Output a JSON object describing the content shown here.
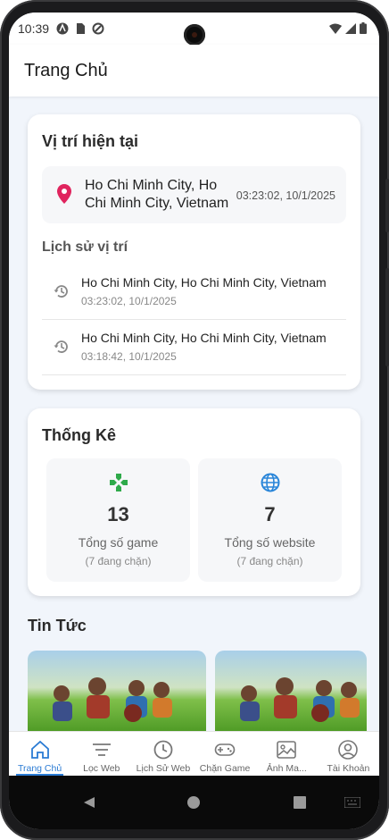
{
  "status_bar": {
    "time": "10:39"
  },
  "app_bar": {
    "title": "Trang Chủ"
  },
  "location_card": {
    "title": "Vị trí hiện tại",
    "current": {
      "address_line1": "Ho Chi Minh City, Ho",
      "address_line2": "Chi Minh City, Vietnam",
      "time": "03:23:02, 10/1/2025"
    },
    "history_title": "Lịch sử vị trí",
    "history": [
      {
        "address": "Ho Chi Minh City, Ho Chi Minh City, Vietnam",
        "time": "03:23:02, 10/1/2025"
      },
      {
        "address": "Ho Chi Minh City, Ho Chi Minh City, Vietnam",
        "time": "03:18:42, 10/1/2025"
      }
    ]
  },
  "stats_card": {
    "title": "Thống Kê",
    "games": {
      "count": "13",
      "label": "Tổng số game",
      "sub": "(7 đang chặn)",
      "icon": "gamepad-icon"
    },
    "websites": {
      "count": "7",
      "label": "Tổng số website",
      "sub": "(7 đang chặn)",
      "icon": "globe-icon"
    }
  },
  "news": {
    "title": "Tin Tức"
  },
  "bottom_nav": [
    {
      "label": "Trang Chủ",
      "icon": "home-icon",
      "active": true
    },
    {
      "label": "Lọc Web",
      "icon": "filter-icon",
      "active": false
    },
    {
      "label": "Lịch Sử Web",
      "icon": "clock-icon",
      "active": false
    },
    {
      "label": "Chặn Game",
      "icon": "gamepad-icon",
      "active": false
    },
    {
      "label": "Ảnh Ma...",
      "icon": "image-icon",
      "active": false
    },
    {
      "label": "Tài Khoản",
      "icon": "account-icon",
      "active": false
    }
  ],
  "colors": {
    "accent": "#2a7bd4",
    "pin": "#e0245e",
    "game_icon": "#2eaa4a",
    "globe_icon": "#2a86d9"
  }
}
